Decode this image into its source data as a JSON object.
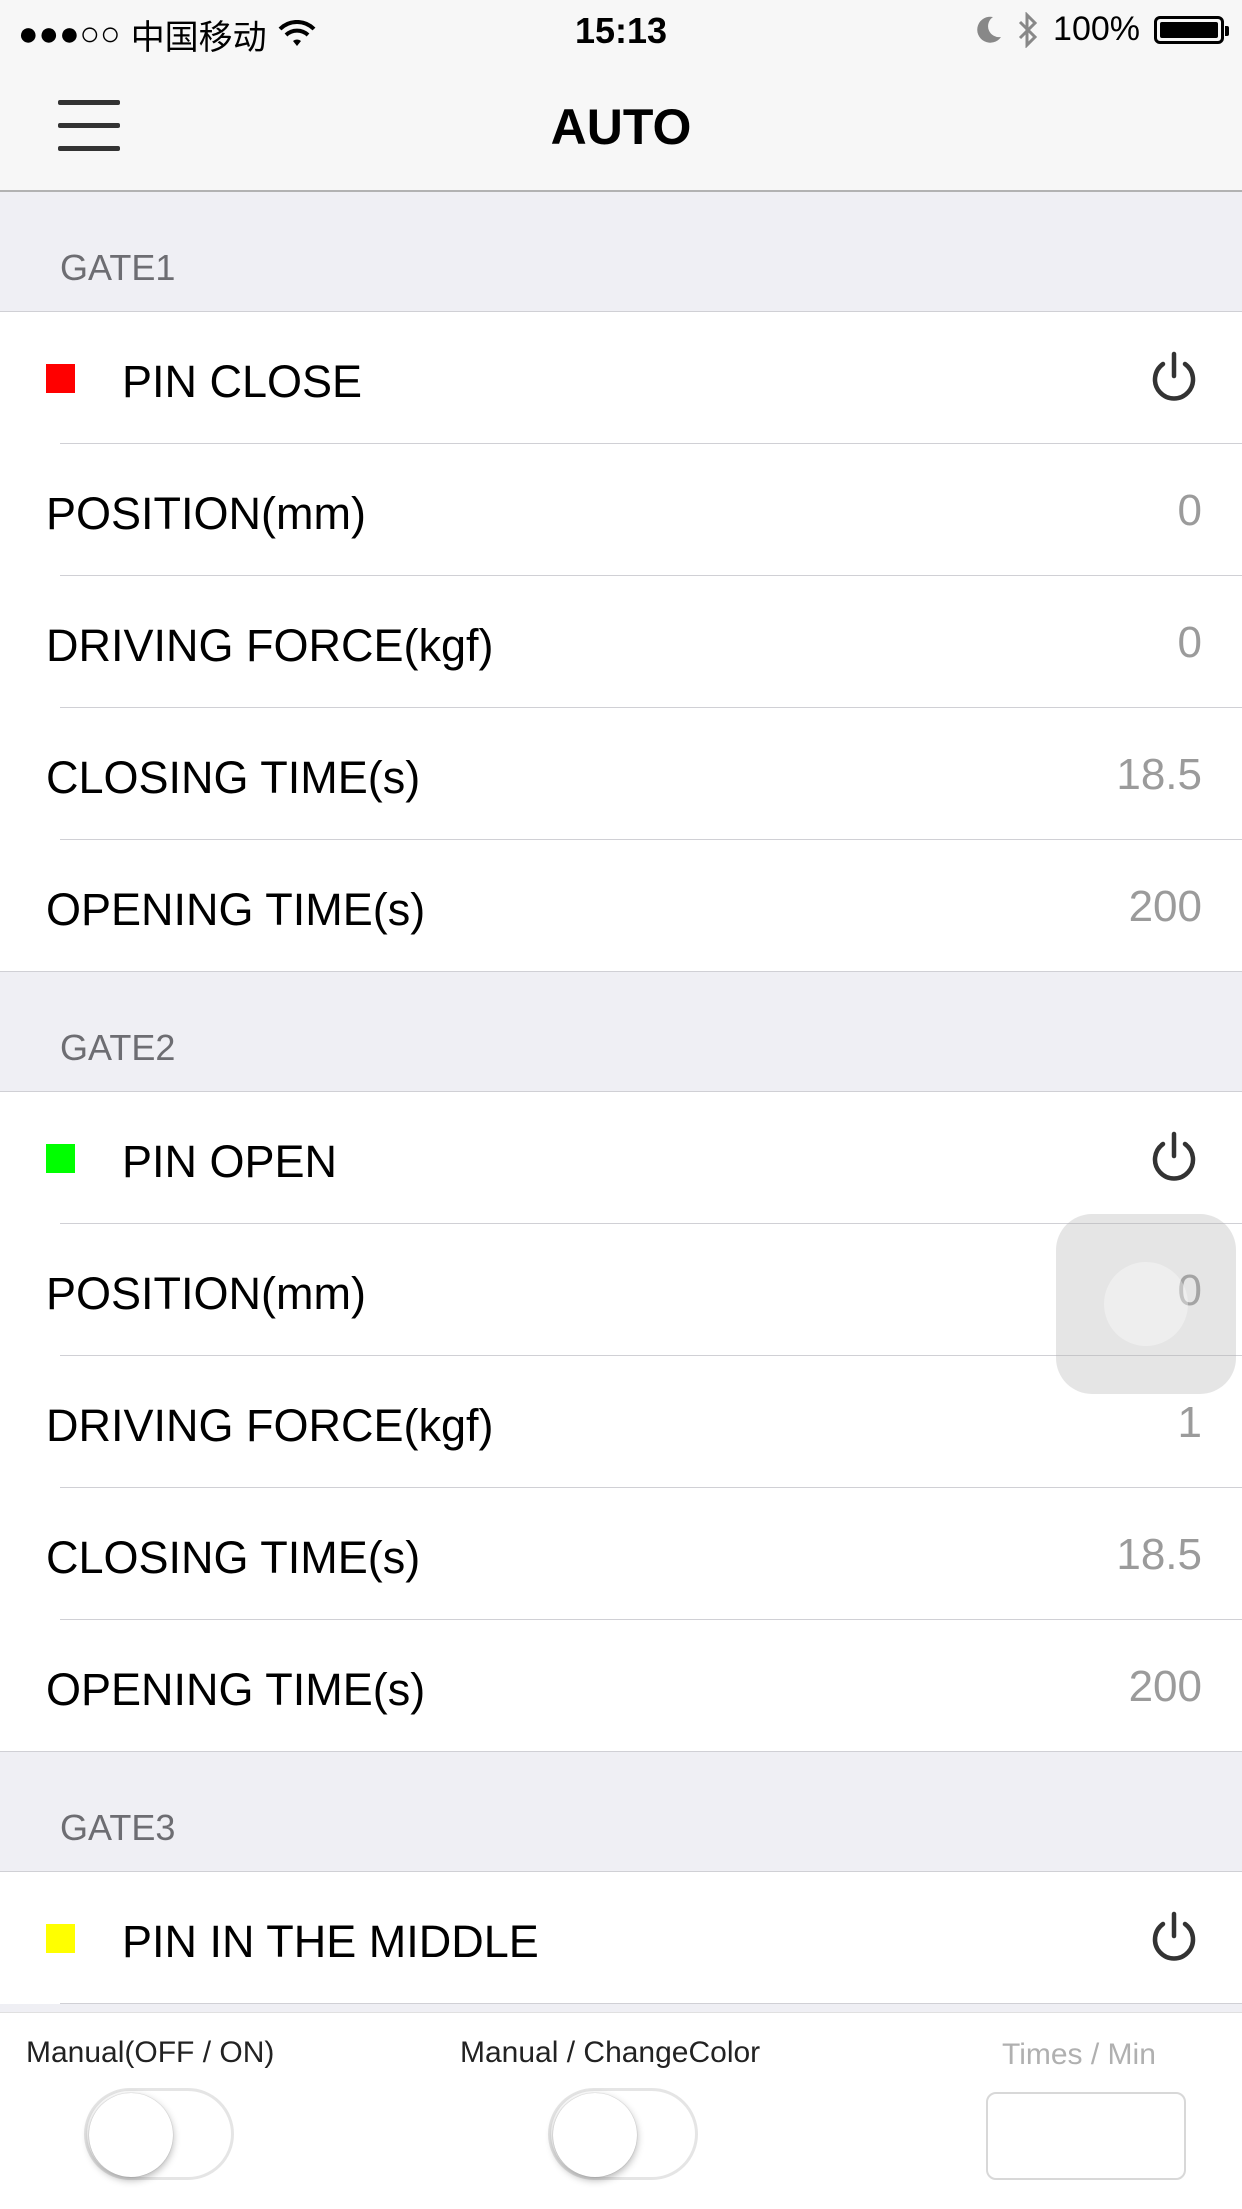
{
  "status_bar": {
    "signal": "●●●○○",
    "carrier": "中国移动",
    "time": "15:13",
    "battery_percent": "100%"
  },
  "nav": {
    "title": "AUTO",
    "menu_icon": "hamburger-menu-icon"
  },
  "gates": [
    {
      "header": "GATE1",
      "status": {
        "label": "PIN CLOSE",
        "color": "#ff0000"
      },
      "rows": [
        {
          "label": "POSITION(mm)",
          "value": "0"
        },
        {
          "label": "DRIVING FORCE(kgf)",
          "value": "0"
        },
        {
          "label": "CLOSING TIME(s)",
          "value": "18.5"
        },
        {
          "label": "OPENING TIME(s)",
          "value": "200"
        }
      ]
    },
    {
      "header": "GATE2",
      "status": {
        "label": "PIN OPEN",
        "color": "#00ff00"
      },
      "rows": [
        {
          "label": "POSITION(mm)",
          "value": "0"
        },
        {
          "label": "DRIVING FORCE(kgf)",
          "value": "1"
        },
        {
          "label": "CLOSING TIME(s)",
          "value": "18.5"
        },
        {
          "label": "OPENING TIME(s)",
          "value": "200"
        }
      ]
    },
    {
      "header": "GATE3",
      "status": {
        "label": "PIN IN THE MIDDLE",
        "color": "#ffff00"
      }
    }
  ],
  "bottom": {
    "manual_label": "Manual(OFF / ON)",
    "manual_on": false,
    "color_label": "Manual / ChangeColor",
    "color_on": false,
    "times_label": "Times / Min",
    "times_value": ""
  }
}
